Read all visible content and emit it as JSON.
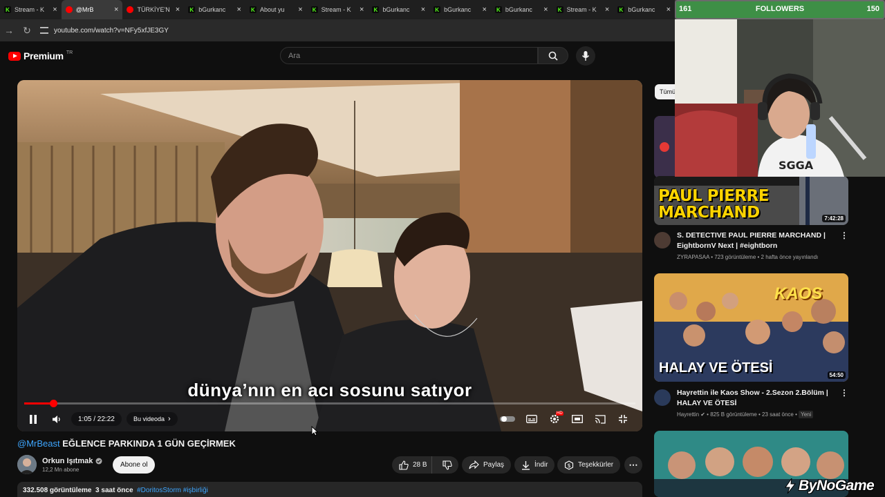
{
  "browser": {
    "tabs": [
      {
        "label": "Stream - K",
        "favicon": "kick"
      },
      {
        "label": "@MrB",
        "favicon": "youtube",
        "active": true
      },
      {
        "label": "TÜRKİYE'N",
        "favicon": "youtube"
      },
      {
        "label": "bGurkanc",
        "favicon": "kick"
      },
      {
        "label": "About yu",
        "favicon": "kick"
      },
      {
        "label": "Stream - K",
        "favicon": "kick"
      },
      {
        "label": "bGurkanc",
        "favicon": "kick"
      },
      {
        "label": "bGurkanc",
        "favicon": "kick"
      },
      {
        "label": "bGurkanc",
        "favicon": "kick"
      },
      {
        "label": "Stream - K",
        "favicon": "kick"
      },
      {
        "label": "bGurkanc",
        "favicon": "kick"
      }
    ],
    "url": "youtube.com/watch?v=NFy5xfJE3GY"
  },
  "header": {
    "logo_text": "Premium",
    "logo_region": "TR",
    "search_placeholder": "Ara"
  },
  "player": {
    "subtitle": "dünya’nın en acı sosunu satıyor",
    "time_current": "1:05",
    "time_total": "22:22",
    "time_display": "1:05 / 22:22",
    "progress_fraction": 0.048,
    "chapter_label": "Bu videoda",
    "hd_badge": "HD"
  },
  "video": {
    "mention": "@MrBeast",
    "title": "EĞLENCE PARKINDA 1 GÜN GEÇİRMEK",
    "channel_name": "Orkun Işıtmak",
    "subscribers": "12,2 Mn abone",
    "subscribe_label": "Abone ol",
    "likes": "28 B",
    "share_label": "Paylaş",
    "download_label": "İndir",
    "thanks_label": "Teşekkürler",
    "views": "332.508 görüntüleme",
    "age": "3 saat önce",
    "hashtags": "#DoritosStorm #işbirliği"
  },
  "sidebar": {
    "chip_label": "Tümü",
    "items": [
      {
        "thumb_text": "PAUL PIERRE MARCHAND",
        "duration": "7:42:28",
        "title": "S. DETECTIVE PAUL PIERRE MARCHAND | EightbornV Next | #eightborn",
        "channel": "ZYRAPASAA",
        "meta": "723 görüntüleme • 2 hafta önce yayınlandı"
      },
      {
        "thumb_text": "HALAY VE ÖTESİ",
        "thumb_logo": "KAOS",
        "duration": "54:50",
        "title": "Hayrettin ile Kaos Show - 2.Sezon 2.Bölüm | HALAY VE ÖTESİ",
        "channel": "Hayrettin",
        "meta": "825 B görüntüleme • 23 saat önce",
        "badge": "Yeni"
      }
    ]
  },
  "overlay": {
    "followers_label": "FOLLOWERS",
    "followers_current": "161",
    "followers_goal": "150",
    "followers_fill": 1.0,
    "watermark": "ByNoGame"
  }
}
